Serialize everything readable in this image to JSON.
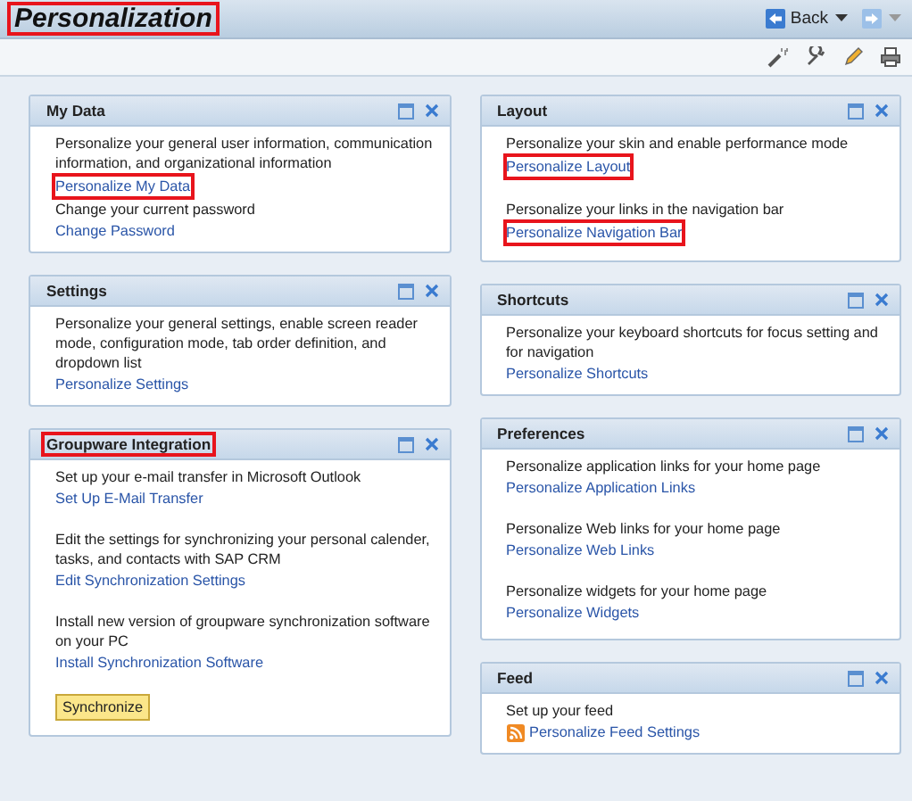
{
  "header": {
    "title": "Personalization",
    "title_highlighted": true,
    "back": "Back"
  },
  "columns": [
    {
      "panels": [
        {
          "title": "My Data",
          "highlighted": false,
          "kind": "compact",
          "groups": [
            {
              "text": "Personalize your general user information, communication information, and organizational information",
              "link": "Personalize My Data",
              "highlighted": true
            },
            {
              "text": "Change your current password",
              "link": "Change Password",
              "highlighted": false
            }
          ]
        },
        {
          "title": "Settings",
          "highlighted": false,
          "kind": "compact",
          "groups": [
            {
              "text": "Personalize your general settings, enable screen reader mode, configuration mode, tab order definition, and dropdown list",
              "link": "Personalize Settings",
              "highlighted": false
            }
          ]
        },
        {
          "title": "Groupware Integration",
          "highlighted": true,
          "kind": "spaced",
          "groups": [
            {
              "text": "Set up your e-mail transfer in Microsoft Outlook",
              "link": "Set Up E-Mail Transfer",
              "highlighted": false
            },
            {
              "text": "Edit the settings for synchronizing your personal calender, tasks, and contacts with SAP CRM",
              "link": "Edit Synchronization Settings",
              "highlighted": false
            },
            {
              "text": "Install new version of groupware synchronization software on your PC",
              "link": "Install Synchronization Software",
              "highlighted": false
            }
          ],
          "button": "Synchronize"
        }
      ]
    },
    {
      "panels": [
        {
          "title": "Layout",
          "highlighted": false,
          "kind": "spaced",
          "groups": [
            {
              "text": "Personalize your skin and enable performance mode",
              "link": "Personalize Layout",
              "highlighted": true
            },
            {
              "text": "Personalize your links in the navigation bar",
              "link": "Personalize Navigation Bar",
              "highlighted": true
            }
          ]
        },
        {
          "title": "Shortcuts",
          "highlighted": false,
          "kind": "compact",
          "groups": [
            {
              "text": "Personalize your keyboard shortcuts for focus setting and for navigation",
              "link": "Personalize Shortcuts",
              "highlighted": false
            }
          ]
        },
        {
          "title": "Preferences",
          "highlighted": false,
          "kind": "spaced",
          "groups": [
            {
              "text": "Personalize application links for your home page",
              "link": "Personalize Application Links",
              "highlighted": false
            },
            {
              "text": "Personalize Web links for your home page",
              "link": "Personalize Web Links",
              "highlighted": false
            },
            {
              "text": "Personalize widgets for your home page",
              "link": "Personalize Widgets",
              "highlighted": false
            }
          ]
        },
        {
          "title": "Feed",
          "highlighted": false,
          "kind": "compact",
          "groups": [
            {
              "text": "Set up your feed",
              "link": "Personalize Feed Settings",
              "highlighted": false,
              "kind": "feed"
            }
          ]
        }
      ]
    }
  ]
}
